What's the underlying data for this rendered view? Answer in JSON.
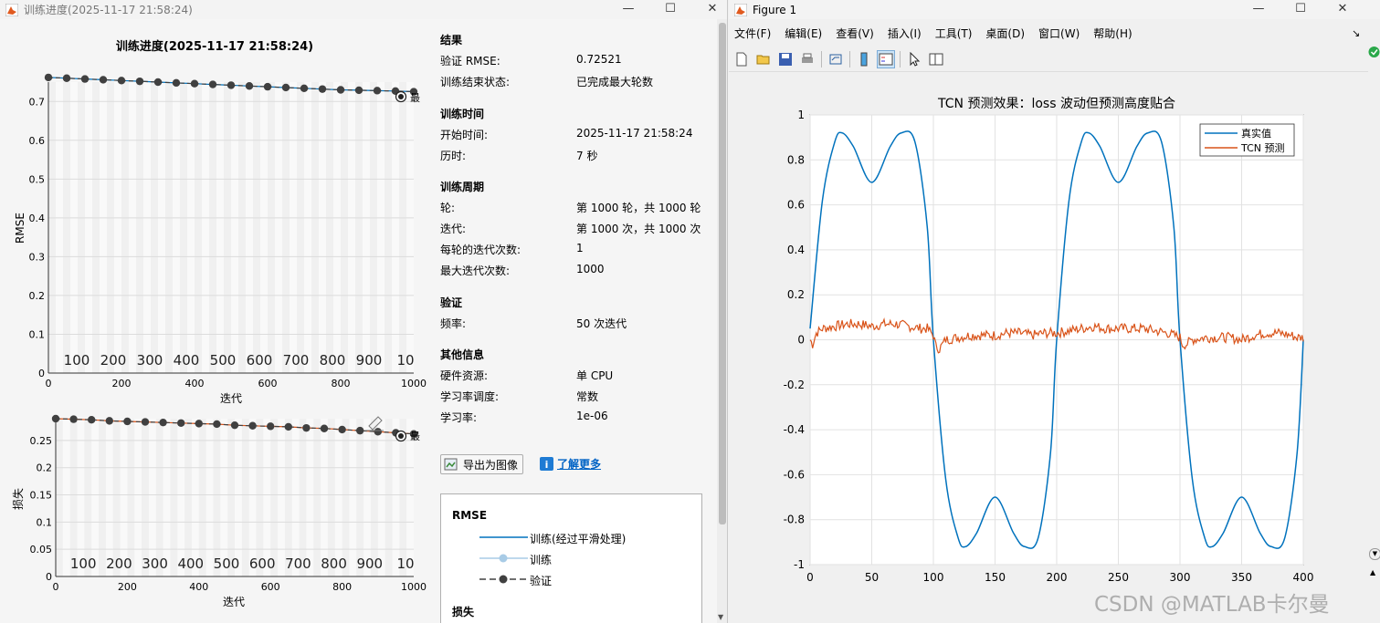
{
  "left_window": {
    "title": "训练进度(2025-11-17 21:58:24)",
    "plot_title": "训练进度(2025-11-17 21:58:24)",
    "rmse_plot": {
      "ylabel": "RMSE",
      "xlabel": "迭代",
      "xticks": [
        "0",
        "200",
        "400",
        "600",
        "800",
        "1000"
      ],
      "yticks": [
        "0",
        "0.1",
        "0.2",
        "0.3",
        "0.4",
        "0.5",
        "0.6",
        "0.7"
      ],
      "inner_ticks": [
        "100",
        "200",
        "300",
        "400",
        "500",
        "600",
        "700",
        "800",
        "900",
        "10"
      ],
      "end_label": "最"
    },
    "loss_plot": {
      "ylabel": "损失",
      "xlabel": "迭代",
      "xticks": [
        "0",
        "200",
        "400",
        "600",
        "800",
        "1000"
      ],
      "yticks": [
        "0",
        "0.05",
        "0.1",
        "0.15",
        "0.2",
        "0.25"
      ],
      "inner_ticks": [
        "100",
        "200",
        "300",
        "400",
        "500",
        "600",
        "700",
        "800",
        "900",
        "10"
      ],
      "end_label": "最"
    },
    "info": {
      "results_title": "结果",
      "results": [
        {
          "label": "验证 RMSE:",
          "value": "0.72521"
        },
        {
          "label": "训练结束状态:",
          "value": "已完成最大轮数"
        }
      ],
      "time_title": "训练时间",
      "time": [
        {
          "label": "开始时间:",
          "value": "2025-11-17 21:58:24"
        },
        {
          "label": "历时:",
          "value": "7 秒"
        }
      ],
      "cycle_title": "训练周期",
      "cycle": [
        {
          "label": "轮:",
          "value": "第 1000 轮，共 1000 轮"
        },
        {
          "label": "迭代:",
          "value": "第 1000 次，共 1000 次"
        },
        {
          "label": "每轮的迭代次数:",
          "value": "1"
        },
        {
          "label": "最大迭代次数:",
          "value": "1000"
        }
      ],
      "validation_title": "验证",
      "validation": [
        {
          "label": "频率:",
          "value": "50 次迭代"
        }
      ],
      "other_title": "其他信息",
      "other": [
        {
          "label": "硬件资源:",
          "value": "单 CPU"
        },
        {
          "label": "学习率调度:",
          "value": "常数"
        },
        {
          "label": "学习率:",
          "value": "1e-06"
        }
      ],
      "export_button": "导出为图像",
      "learn_more": "了解更多"
    },
    "legend": {
      "rmse_title": "RMSE",
      "rmse_items": [
        "训练(经过平滑处理)",
        "训练",
        "验证"
      ],
      "loss_title": "损失"
    }
  },
  "right_window": {
    "title": "Figure 1",
    "menus": [
      "文件(F)",
      "编辑(E)",
      "查看(V)",
      "插入(I)",
      "工具(T)",
      "桌面(D)",
      "窗口(W)",
      "帮助(H)"
    ]
  },
  "watermark": "CSDN @MATLAB卡尔曼",
  "chart_data": [
    {
      "type": "line",
      "title": "",
      "xlabel": "迭代",
      "ylabel": "RMSE",
      "xlim": [
        0,
        1000
      ],
      "ylim": [
        0,
        0.75
      ],
      "series": [
        {
          "name": "验证",
          "color": "#404040",
          "x": [
            0,
            50,
            100,
            150,
            200,
            250,
            300,
            350,
            400,
            450,
            500,
            550,
            600,
            650,
            700,
            750,
            800,
            850,
            900,
            950,
            1000
          ],
          "y": [
            0.762,
            0.76,
            0.758,
            0.756,
            0.754,
            0.752,
            0.75,
            0.748,
            0.746,
            0.744,
            0.742,
            0.74,
            0.738,
            0.736,
            0.734,
            0.732,
            0.73,
            0.729,
            0.728,
            0.727,
            0.7252
          ]
        }
      ]
    },
    {
      "type": "line",
      "title": "",
      "xlabel": "迭代",
      "ylabel": "损失",
      "xlim": [
        0,
        1000
      ],
      "ylim": [
        0,
        0.29
      ],
      "series": [
        {
          "name": "验证",
          "color": "#404040",
          "x": [
            0,
            50,
            100,
            150,
            200,
            250,
            300,
            350,
            400,
            450,
            500,
            550,
            600,
            650,
            700,
            750,
            800,
            850,
            900,
            950,
            1000
          ],
          "y": [
            0.29,
            0.289,
            0.288,
            0.286,
            0.285,
            0.284,
            0.283,
            0.282,
            0.281,
            0.28,
            0.278,
            0.277,
            0.276,
            0.275,
            0.273,
            0.272,
            0.27,
            0.268,
            0.266,
            0.264,
            0.262
          ]
        }
      ]
    },
    {
      "type": "line",
      "title": "TCN 预测效果：loss 波动但预测高度贴合",
      "xlabel": "",
      "ylabel": "",
      "xlim": [
        0,
        400
      ],
      "ylim": [
        -1,
        1
      ],
      "xticks": [
        0,
        50,
        100,
        150,
        200,
        250,
        300,
        350,
        400
      ],
      "yticks": [
        -1,
        -0.8,
        -0.6,
        -0.4,
        -0.2,
        0,
        0.2,
        0.4,
        0.6,
        0.8,
        1
      ],
      "grid": true,
      "legend_position": "top-right",
      "series": [
        {
          "name": "真实值",
          "color": "#0072BD",
          "x": [
            0,
            10,
            20,
            26,
            35,
            50,
            65,
            74,
            85,
            95,
            100,
            110,
            120,
            126,
            135,
            150,
            165,
            174,
            185,
            195,
            200,
            210,
            220,
            226,
            235,
            250,
            265,
            274,
            285,
            295,
            300,
            310,
            320,
            326,
            335,
            350,
            365,
            374,
            385,
            395,
            400
          ],
          "y": [
            0.05,
            0.62,
            0.88,
            0.92,
            0.86,
            0.7,
            0.86,
            0.92,
            0.88,
            0.5,
            0.0,
            -0.62,
            -0.88,
            -0.92,
            -0.86,
            -0.7,
            -0.86,
            -0.92,
            -0.88,
            -0.5,
            0.0,
            0.62,
            0.88,
            0.92,
            0.86,
            0.7,
            0.86,
            0.92,
            0.88,
            0.5,
            0.0,
            -0.62,
            -0.88,
            -0.92,
            -0.86,
            -0.7,
            -0.86,
            -0.92,
            -0.88,
            -0.5,
            0.0
          ]
        },
        {
          "name": "TCN 预测",
          "color": "#D95319",
          "x": [
            0,
            2,
            5,
            10,
            20,
            30,
            40,
            50,
            60,
            70,
            80,
            90,
            95,
            100,
            102,
            105,
            110,
            120,
            130,
            140,
            150,
            160,
            170,
            180,
            190,
            200,
            210,
            220,
            230,
            240,
            250,
            260,
            270,
            280,
            290,
            300,
            302,
            305,
            310,
            320,
            330,
            340,
            350,
            360,
            370,
            380,
            390,
            395,
            400
          ],
          "y": [
            0.0,
            -0.02,
            0.03,
            0.05,
            0.06,
            0.07,
            0.07,
            0.06,
            0.07,
            0.07,
            0.06,
            0.05,
            0.05,
            0.02,
            -0.03,
            -0.04,
            0.0,
            0.01,
            0.02,
            0.02,
            0.02,
            0.03,
            0.03,
            0.02,
            0.03,
            0.03,
            0.04,
            0.05,
            0.06,
            0.05,
            0.05,
            0.05,
            0.05,
            0.04,
            0.03,
            0.01,
            -0.02,
            -0.02,
            0.0,
            0.01,
            0.01,
            0.01,
            0.0,
            0.02,
            0.03,
            0.03,
            0.02,
            0.01,
            0.01
          ]
        }
      ]
    }
  ]
}
